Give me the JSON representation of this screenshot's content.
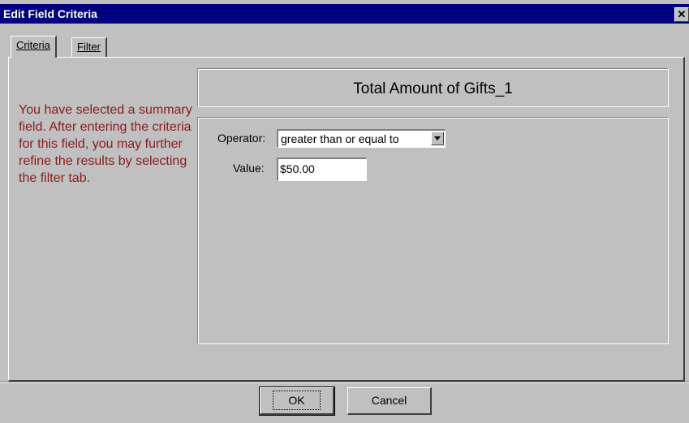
{
  "window": {
    "title": "Edit Field Criteria",
    "close_glyph": "✕"
  },
  "tabs": [
    {
      "label": "Criteria",
      "mnemonic": "C",
      "active": true
    },
    {
      "label": "Filter",
      "mnemonic": "F",
      "active": false
    }
  ],
  "info_text": "You have selected a summary field.  After entering the criteria for this field, you may further refine the results by selecting the filter tab.",
  "field": {
    "title": "Total Amount of Gifts_1"
  },
  "operator": {
    "label": "Operator:",
    "value": "greater than or equal to"
  },
  "value_field": {
    "label": "Value:",
    "value": "$50.00"
  },
  "buttons": {
    "ok": "OK",
    "cancel": "Cancel"
  },
  "colors": {
    "titlebar": "#000080",
    "face": "#c0c0c0",
    "info_text": "#8b1a1a"
  },
  "icons": {
    "close": "close-icon",
    "dropdown": "chevron-down-icon"
  }
}
